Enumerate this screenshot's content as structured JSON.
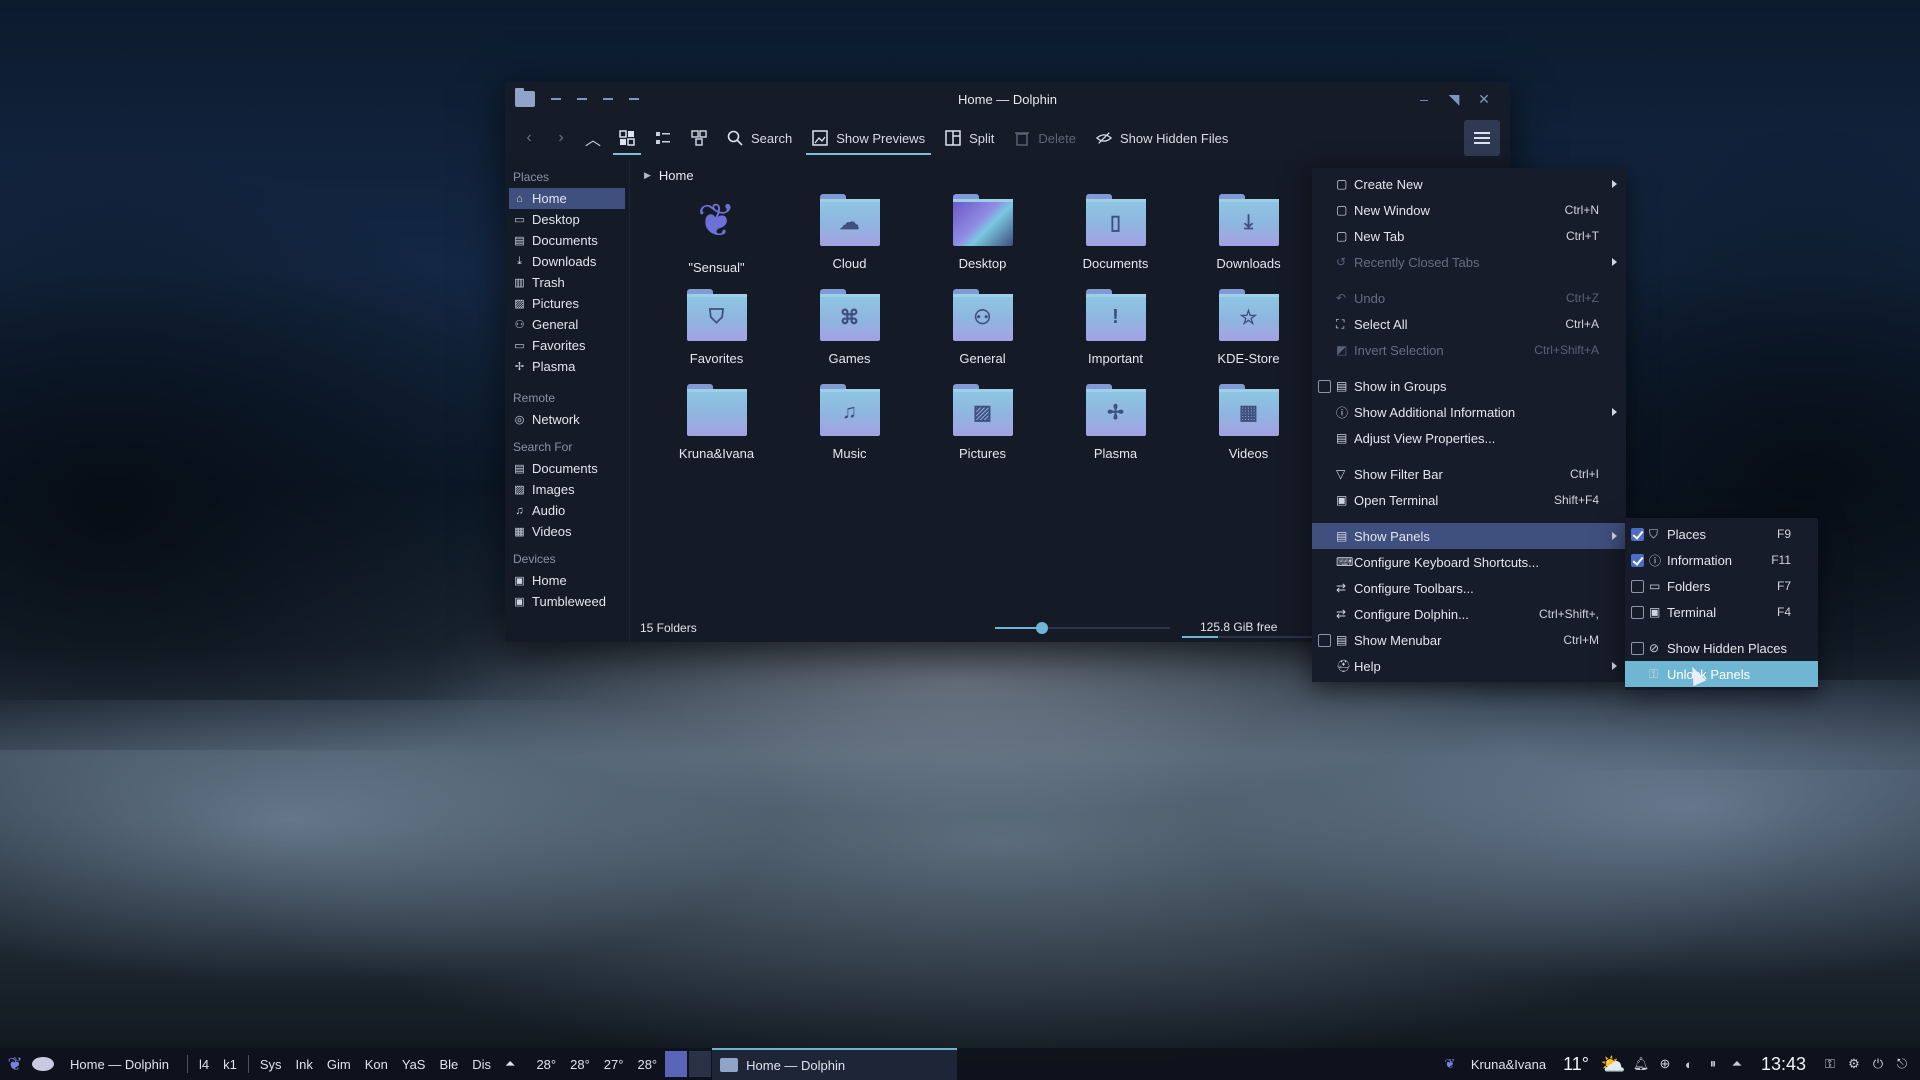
{
  "window": {
    "title": "Home — Dolphin",
    "controls": {
      "minimize": "–",
      "maximize": "◥",
      "close": "✕"
    }
  },
  "toolbar": {
    "back_icon": "‹",
    "forward_icon": "›",
    "up_icon": "︿",
    "search_label": "Search",
    "show_previews_label": "Show Previews",
    "split_label": "Split",
    "delete_label": "Delete",
    "show_hidden_label": "Show Hidden Files"
  },
  "sidebar": {
    "places_header": "Places",
    "places": [
      {
        "label": "Home",
        "icon": "⌂"
      },
      {
        "label": "Desktop",
        "icon": "▭"
      },
      {
        "label": "Documents",
        "icon": "▤"
      },
      {
        "label": "Downloads",
        "icon": "⤓"
      },
      {
        "label": "Trash",
        "icon": "▥"
      },
      {
        "label": "Pictures",
        "icon": "▨"
      },
      {
        "label": "General",
        "icon": "⚇"
      },
      {
        "label": "Favorites",
        "icon": "▭"
      },
      {
        "label": "Plasma",
        "icon": "✢"
      }
    ],
    "remote_header": "Remote",
    "remote": [
      {
        "label": "Network",
        "icon": "◎"
      }
    ],
    "search_header": "Search For",
    "search": [
      {
        "label": "Documents",
        "icon": "▤"
      },
      {
        "label": "Images",
        "icon": "▨"
      },
      {
        "label": "Audio",
        "icon": "♫"
      },
      {
        "label": "Videos",
        "icon": "▦"
      }
    ],
    "devices_header": "Devices",
    "devices": [
      {
        "label": "Home",
        "icon": "▣"
      },
      {
        "label": "Tumbleweed",
        "icon": "▣"
      }
    ]
  },
  "content": {
    "breadcrumb": "Home",
    "items": [
      {
        "label": "\"Sensual\"",
        "glyph": "❦"
      },
      {
        "label": "Cloud",
        "glyph": "☁"
      },
      {
        "label": "Desktop",
        "glyph": ""
      },
      {
        "label": "Documents",
        "glyph": "▯"
      },
      {
        "label": "Downloads",
        "glyph": "⤓"
      },
      {
        "label": "Favorites",
        "glyph": "⛉"
      },
      {
        "label": "Games",
        "glyph": "⌘"
      },
      {
        "label": "General",
        "glyph": "⚇"
      },
      {
        "label": "Important",
        "glyph": "!"
      },
      {
        "label": "KDE-Store",
        "glyph": "☆"
      },
      {
        "label": "Kruna&Ivana",
        "glyph": ""
      },
      {
        "label": "Music",
        "glyph": "♫"
      },
      {
        "label": "Pictures",
        "glyph": "▨"
      },
      {
        "label": "Plasma",
        "glyph": "✢"
      },
      {
        "label": "Videos",
        "glyph": "▦"
      }
    ]
  },
  "status": {
    "count": "15 Folders",
    "zoom_fraction": 0.27,
    "free": "125.8 GiB free",
    "used_fraction": 0.21
  },
  "menu": {
    "items": [
      {
        "label": "Create New",
        "icon": "▢",
        "shortcut": "",
        "submenu": true
      },
      {
        "label": "New Window",
        "icon": "▢",
        "shortcut": "Ctrl+N"
      },
      {
        "label": "New Tab",
        "icon": "▢",
        "shortcut": "Ctrl+T"
      },
      {
        "label": "Recently Closed Tabs",
        "icon": "↺",
        "shortcut": "",
        "submenu": true,
        "disabled": true
      },
      {
        "sep": true
      },
      {
        "label": "Undo",
        "icon": "↶",
        "shortcut": "Ctrl+Z",
        "disabled": true
      },
      {
        "label": "Select All",
        "icon": "⛶",
        "shortcut": "Ctrl+A"
      },
      {
        "label": "Invert Selection",
        "icon": "◩",
        "shortcut": "Ctrl+Shift+A",
        "disabled": true
      },
      {
        "sep": true
      },
      {
        "label": "Show in Groups",
        "icon": "▤",
        "shortcut": "",
        "checkbox": true,
        "checked": false
      },
      {
        "label": "Show Additional Information",
        "icon": "ⓘ",
        "shortcut": "",
        "submenu": true
      },
      {
        "label": "Adjust View Properties...",
        "icon": "▤",
        "shortcut": ""
      },
      {
        "sep": true
      },
      {
        "label": "Show Filter Bar",
        "icon": "▽",
        "shortcut": "Ctrl+I"
      },
      {
        "label": "Open Terminal",
        "icon": "▣",
        "shortcut": "Shift+F4"
      },
      {
        "sep": true
      },
      {
        "label": "Show Panels",
        "icon": "▤",
        "shortcut": "",
        "submenu": true,
        "highlighted": true
      },
      {
        "label": "Configure Keyboard Shortcuts...",
        "icon": "⌨",
        "shortcut": ""
      },
      {
        "label": "Configure Toolbars...",
        "icon": "⇄",
        "shortcut": ""
      },
      {
        "label": "Configure Dolphin...",
        "icon": "⇄",
        "shortcut": "Ctrl+Shift+,"
      },
      {
        "label": "Show Menubar",
        "icon": "▤",
        "shortcut": "Ctrl+M",
        "checkbox": true,
        "checked": false
      },
      {
        "label": "Help",
        "icon": "⛑",
        "shortcut": "",
        "submenu": true
      }
    ]
  },
  "submenu": {
    "items": [
      {
        "label": "Places",
        "icon": "⛉",
        "shortcut": "F9",
        "checkbox": true,
        "checked": true
      },
      {
        "label": "Information",
        "icon": "ⓘ",
        "shortcut": "F11",
        "checkbox": true,
        "checked": true
      },
      {
        "label": "Folders",
        "icon": "▭",
        "shortcut": "F7",
        "checkbox": true,
        "checked": false
      },
      {
        "label": "Terminal",
        "icon": "▣",
        "shortcut": "F4",
        "checkbox": true,
        "checked": false
      },
      {
        "sep": true
      },
      {
        "label": "Show Hidden Places",
        "icon": "⊘",
        "shortcut": "",
        "checkbox": true,
        "checked": false
      },
      {
        "label": "Unlock Panels",
        "icon": "⚿",
        "shortcut": "",
        "highlighted": true
      }
    ]
  },
  "taskbar": {
    "active_title": "Home — Dolphin",
    "shortcuts": [
      "l4",
      "k1"
    ],
    "apps": [
      "Sys",
      "Ink",
      "Gim",
      "Kon",
      "YaS",
      "Ble",
      "Dis"
    ],
    "temps": [
      "28°",
      "28°",
      "27°",
      "28°"
    ],
    "task_title": "Home — Dolphin",
    "user": "Kruna&Ivana",
    "weather_temp": "11°",
    "weather_icon": "⛅",
    "clock": "13:43"
  }
}
